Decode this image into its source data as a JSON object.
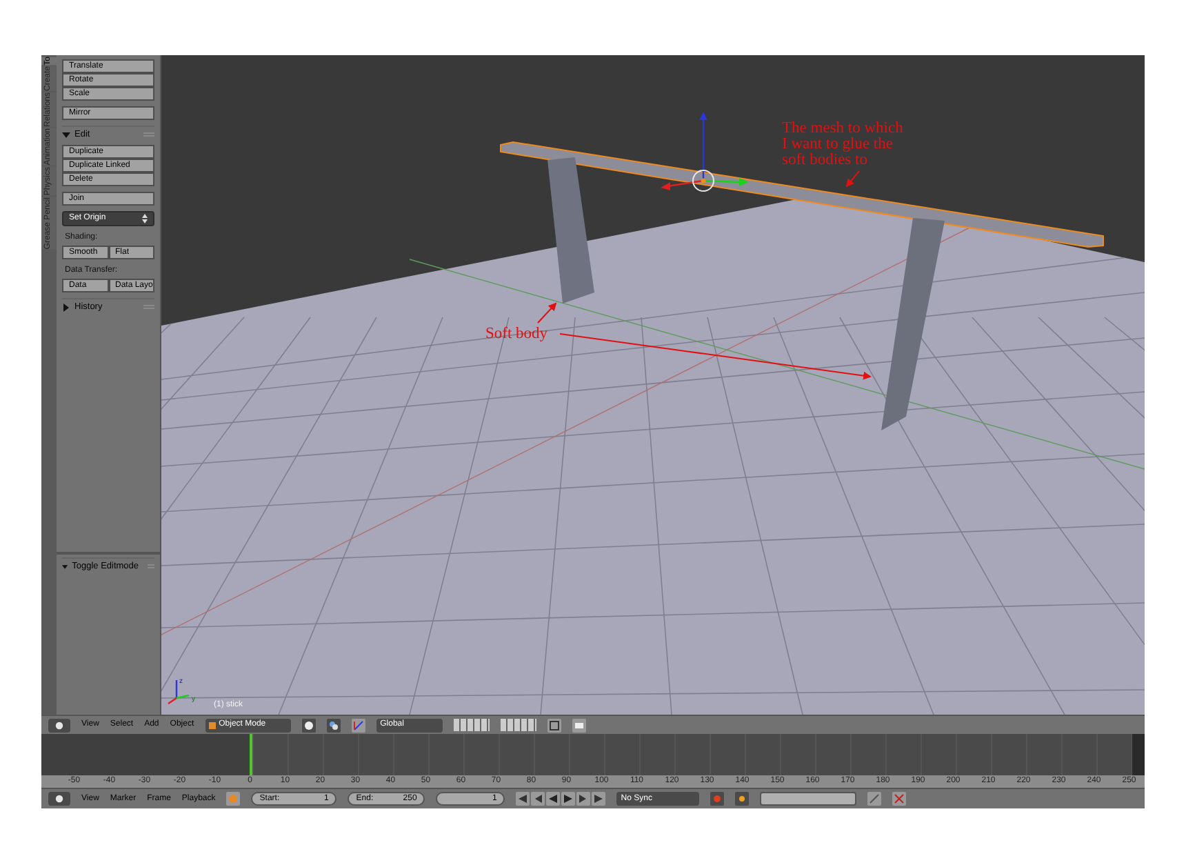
{
  "tool_tabs": [
    {
      "label": "To",
      "selected": true
    },
    {
      "label": "Create",
      "selected": false
    },
    {
      "label": "Relations",
      "selected": false
    },
    {
      "label": "Animation",
      "selected": false
    },
    {
      "label": "Physics",
      "selected": false
    },
    {
      "label": "Grease Pencil",
      "selected": false
    }
  ],
  "tool_panel": {
    "sections": [
      {
        "kind": "buttons",
        "items": [
          "Translate",
          "Rotate",
          "Scale"
        ]
      },
      {
        "kind": "buttons",
        "items": [
          "Mirror"
        ]
      },
      {
        "kind": "header",
        "label": "Edit",
        "expanded": true
      },
      {
        "kind": "buttons",
        "items": [
          "Duplicate",
          "Duplicate Linked",
          "Delete"
        ]
      },
      {
        "kind": "buttons",
        "items": [
          "Join"
        ]
      },
      {
        "kind": "dropdown",
        "label": "Set Origin"
      },
      {
        "kind": "label",
        "label": "Shading:"
      },
      {
        "kind": "row",
        "items": [
          "Smooth",
          "Flat"
        ]
      },
      {
        "kind": "label",
        "label": "Data Transfer:"
      },
      {
        "kind": "row",
        "items": [
          "Data",
          "Data Layo"
        ]
      },
      {
        "kind": "header",
        "label": "History",
        "expanded": false
      }
    ]
  },
  "operator_panel": {
    "label": "Toggle Editmode",
    "expanded": true
  },
  "viewport": {
    "annotations": [
      {
        "lines": [
          "The mesh to which",
          "I want to glue the",
          "soft bodies to"
        ]
      },
      {
        "lines": [
          "Soft body"
        ]
      }
    ],
    "axis_labels": [
      "z",
      "y"
    ],
    "status": "(1) stick"
  },
  "viewport_header": {
    "menus": [
      "View",
      "Select",
      "Add",
      "Object"
    ],
    "mode": "Object Mode",
    "orientation": "Global"
  },
  "timeline": {
    "ticks": [
      "-50",
      "-40",
      "-30",
      "-20",
      "-10",
      "0",
      "10",
      "20",
      "30",
      "40",
      "50",
      "60",
      "70",
      "80",
      "90",
      "100",
      "110",
      "120",
      "130",
      "140",
      "150",
      "160",
      "170",
      "180",
      "190",
      "200",
      "210",
      "220",
      "230",
      "240",
      "250"
    ]
  },
  "timeline_header": {
    "menus": [
      "View",
      "Marker",
      "Frame",
      "Playback"
    ],
    "start": {
      "label": "Start:",
      "value": "1"
    },
    "end": {
      "label": "End:",
      "value": "250"
    },
    "current_frame": "1",
    "sync": "No Sync"
  }
}
